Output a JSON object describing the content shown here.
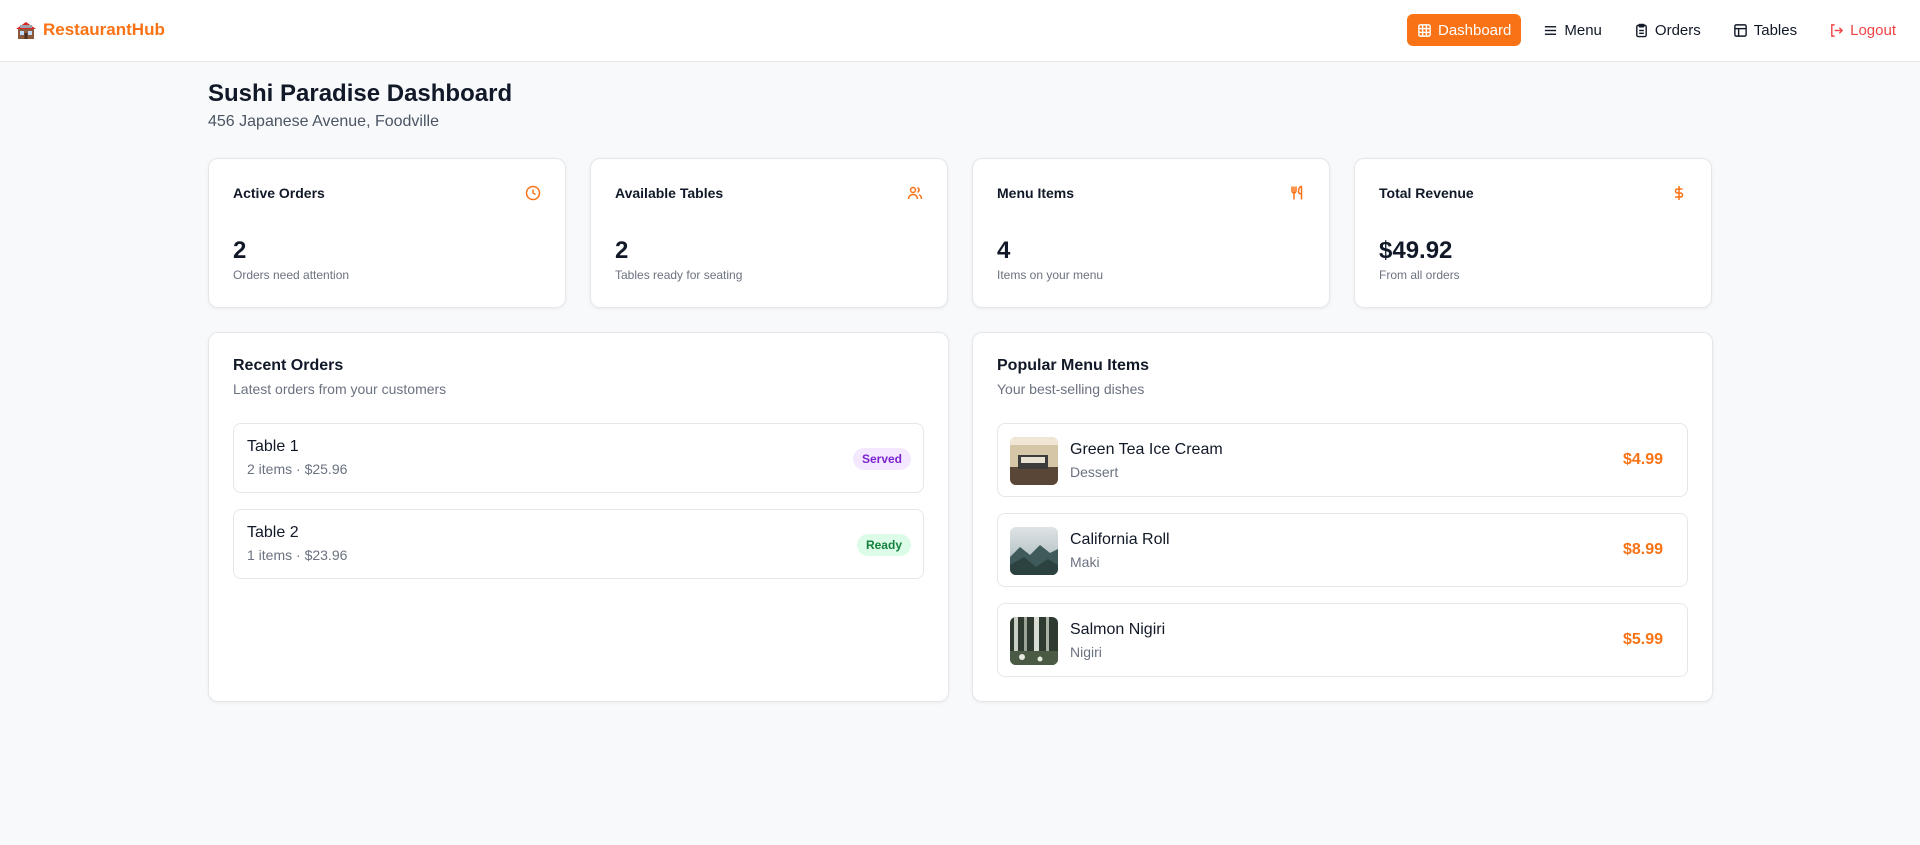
{
  "brand": {
    "name": "RestaurantHub",
    "icon": "restaurant-building-icon"
  },
  "nav": {
    "items": [
      {
        "label": "Dashboard",
        "icon": "grid-icon",
        "active": true
      },
      {
        "label": "Menu",
        "icon": "hamburger-menu-icon"
      },
      {
        "label": "Orders",
        "icon": "clipboard-icon"
      },
      {
        "label": "Tables",
        "icon": "table-icon"
      },
      {
        "label": "Logout",
        "icon": "logout-icon"
      }
    ]
  },
  "header": {
    "title": "Sushi Paradise Dashboard",
    "address": "456 Japanese Avenue, Foodville"
  },
  "stats": [
    {
      "title": "Active Orders",
      "value": "2",
      "note": "Orders need attention",
      "icon": "clock-icon"
    },
    {
      "title": "Available Tables",
      "value": "2",
      "note": "Tables ready for seating",
      "icon": "users-icon"
    },
    {
      "title": "Menu Items",
      "value": "4",
      "note": "Items on your menu",
      "icon": "utensils-icon"
    },
    {
      "title": "Total Revenue",
      "value": "$49.92",
      "note": "From all orders",
      "icon": "dollar-icon"
    }
  ],
  "recent_orders": {
    "title": "Recent Orders",
    "subtitle": "Latest orders from your customers",
    "orders": [
      {
        "table": "Table 1",
        "meta": "2 items · $25.96",
        "status": "Served"
      },
      {
        "table": "Table 2",
        "meta": "1 items · $23.96",
        "status": "Ready"
      }
    ]
  },
  "popular_items": {
    "title": "Popular Menu Items",
    "subtitle": "Your best-selling dishes",
    "items": [
      {
        "name": "Green Tea Ice Cream",
        "category": "Dessert",
        "price": "$4.99"
      },
      {
        "name": "California Roll",
        "category": "Maki",
        "price": "$8.99"
      },
      {
        "name": "Salmon Nigiri",
        "category": "Nigiri",
        "price": "$5.99"
      }
    ]
  },
  "colors": {
    "accent": "#f97316",
    "logout": "#ef4444",
    "served_bg": "#f3e8ff",
    "served_text": "#7e22ce",
    "ready_bg": "#dcfce7",
    "ready_text": "#15803d"
  }
}
